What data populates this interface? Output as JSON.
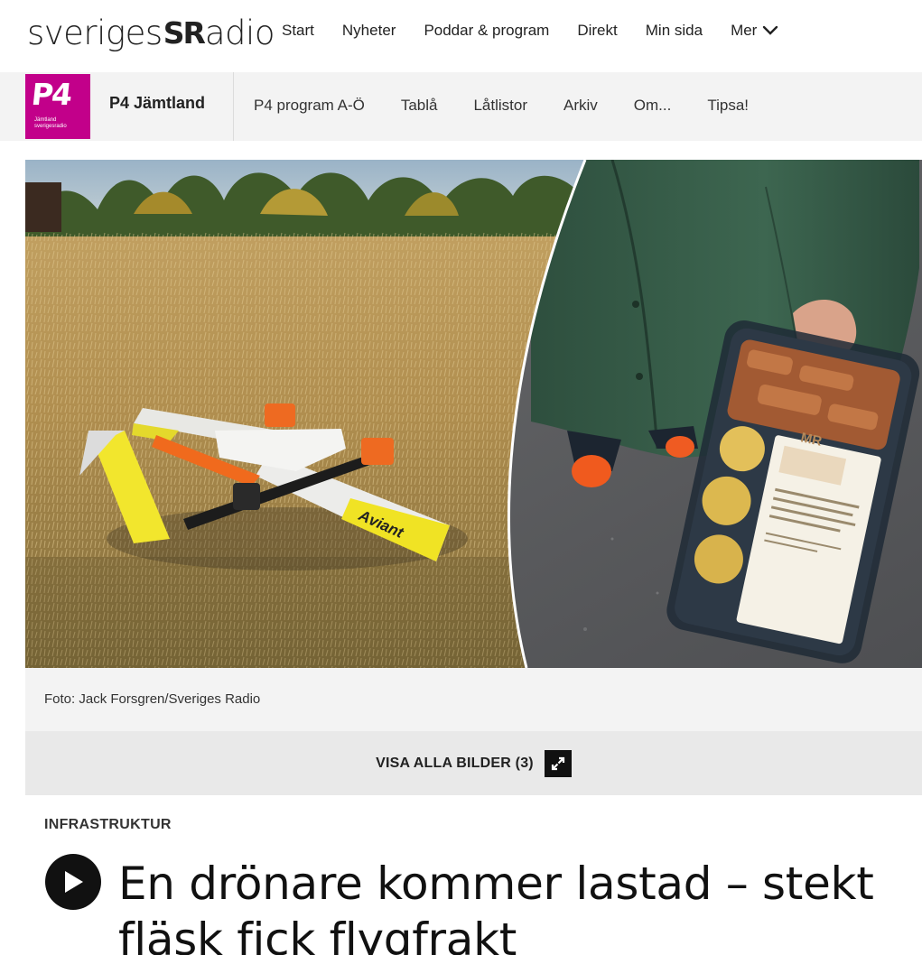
{
  "header": {
    "logo": {
      "text_left": "sveriges",
      "text_mark": "SR",
      "text_right": "adio"
    },
    "nav": [
      {
        "label": "Start"
      },
      {
        "label": "Nyheter"
      },
      {
        "label": "Poddar & program"
      },
      {
        "label": "Direkt"
      },
      {
        "label": "Min sida"
      },
      {
        "label": "Mer",
        "icon": "chevron-down-icon"
      }
    ]
  },
  "channel": {
    "logo": {
      "big": "P4",
      "small_line1": "Jämtland",
      "small_line2": "sverigesradio",
      "color": "#c2008a"
    },
    "title": "P4 Jämtland",
    "nav": [
      {
        "label": "P4 program A-Ö"
      },
      {
        "label": "Tablå"
      },
      {
        "label": "Låtlistor"
      },
      {
        "label": "Arkiv"
      },
      {
        "label": "Om..."
      },
      {
        "label": "Tipsa!"
      }
    ]
  },
  "hero": {
    "drone_brand": "Aviant",
    "package_label": "MR"
  },
  "caption": "Foto: Jack Forsgren/Sveriges Radio",
  "gallery": {
    "label": "VISA ALLA BILDER (3)",
    "icon": "expand-icon"
  },
  "article": {
    "category": "INFRASTRUKTUR",
    "headline": "En drönare kommer lastad – stekt fläsk fick flygfrakt",
    "play_icon": "play-icon"
  }
}
